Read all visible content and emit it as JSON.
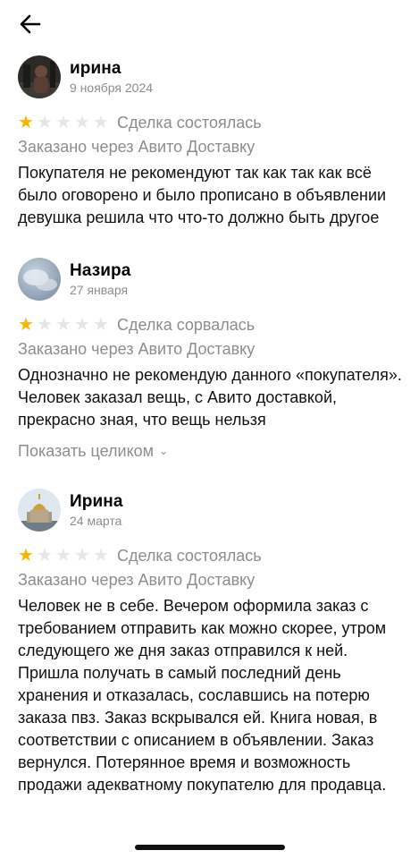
{
  "header": {
    "back_icon": "arrow-left-icon"
  },
  "reviews": [
    {
      "name": "ирина",
      "date": "9 ноября 2024",
      "rating": 1,
      "max_rating": 5,
      "deal_status": "Сделка состоялась",
      "delivery": "Заказано через Авито Доставку",
      "text": "Покупателя не рекомендуют так как так как всё было оговорено и было прописано в объявлении девушка решила что что-то должно быть другое"
    },
    {
      "name": "Назира",
      "date": "27 января",
      "rating": 1,
      "max_rating": 5,
      "deal_status": "Сделка сорвалась",
      "delivery": "Заказано через Авито Доставку",
      "text": "Однозначно не рекомендую данного «покупателя». Человек заказал вещь, с Авито доставкой, прекрасно зная, что вещь нельзя",
      "show_more": "Показать целиком"
    },
    {
      "name": "Ирина",
      "date": "24 марта",
      "rating": 1,
      "max_rating": 5,
      "deal_status": "Сделка состоялась",
      "delivery": "Заказано через Авито Доставку",
      "text": "Человек не в себе. Вечером оформила заказ с требованием отправить как можно скорее, утром следующего же дня заказ отправился к ней. Пришла получать в самый последний день хранения и отказалась, сославшись на потерю заказа пвз. Заказ вскрывался ей. Книга новая, в соответствии с описанием в объявлении. Заказ вернулся. Потерянное время и возможность продажи адекватному покупателю для продавца."
    }
  ],
  "colors": {
    "star_active": "#f7b500",
    "star_inactive": "#e6e6e6",
    "secondary_text": "#8d8d8d"
  }
}
